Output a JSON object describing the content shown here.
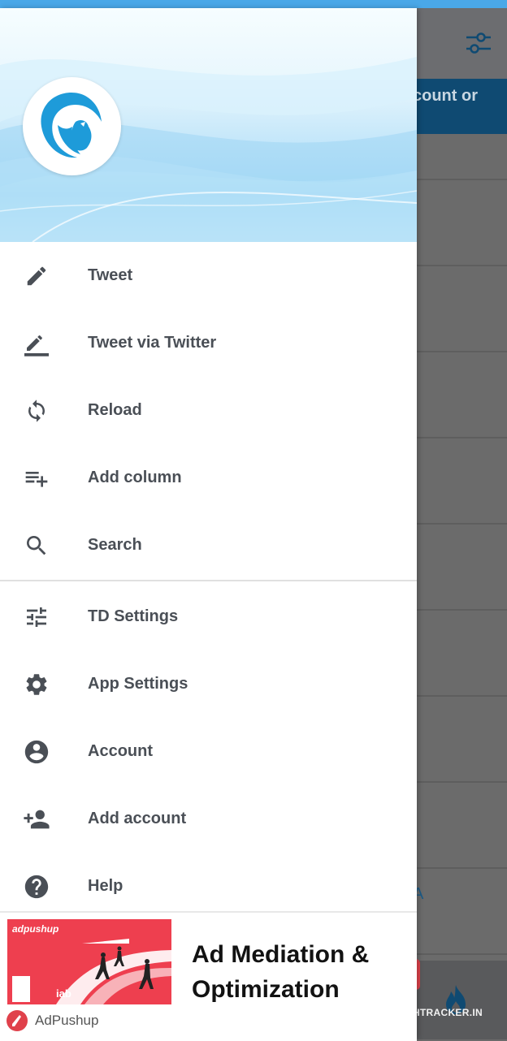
{
  "background": {
    "banner_text": "ccount or",
    "link_letter": "A",
    "watermark": "CHTRACKER.IN"
  },
  "menu": {
    "primary": [
      {
        "label": "Tweet",
        "icon": "pencil-icon"
      },
      {
        "label": "Tweet via Twitter",
        "icon": "compose-underline-icon"
      },
      {
        "label": "Reload",
        "icon": "reload-icon"
      },
      {
        "label": "Add column",
        "icon": "playlist-add-icon"
      },
      {
        "label": "Search",
        "icon": "search-icon"
      }
    ],
    "secondary": [
      {
        "label": "TD Settings",
        "icon": "tune-icon"
      },
      {
        "label": "App Settings",
        "icon": "gear-icon"
      },
      {
        "label": "Account",
        "icon": "account-circle-icon"
      },
      {
        "label": "Add account",
        "icon": "person-add-icon"
      },
      {
        "label": "Help",
        "icon": "help-icon"
      }
    ]
  },
  "ad": {
    "brand": "adpushup",
    "headline": "Ad Mediation & Optimization",
    "advertiser": "AdPushup"
  },
  "colors": {
    "status_bar": "#4aa8e8",
    "icon": "#4a4f56",
    "bird_blue": "#1e9bd9",
    "ad_red": "#ee3f4f"
  }
}
